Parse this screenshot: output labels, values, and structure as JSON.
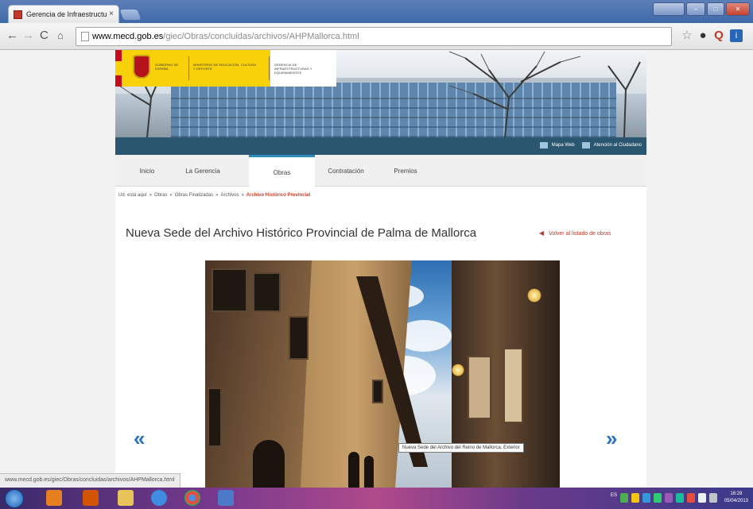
{
  "browser": {
    "tab_title": "Gerencia de Infraestructu",
    "tab_close": "×",
    "user_button": "",
    "url_host": "www.mecd.gob.es",
    "url_path": "/giec/Obras/concluidas/archivos/AHPMallorca.html",
    "status_url": "www.mecd.gob.es/giec/Obras/concluidas/archivos/AHPMallorca.html",
    "icons": [
      "back-icon",
      "forward-icon",
      "reload-icon",
      "home-icon",
      "star-icon"
    ]
  },
  "header": {
    "logo_gobierno": "GOBIERNO DE ESPAÑA",
    "logo_ministerio": "MINISTERIO DE EDUCACIÓN, CULTURA Y DEPORTE",
    "logo_gerencia": "GERENCIA DE INFRAESTRUCTURAS Y EQUIPAMIENTOS",
    "mapa_web": "Mapa Web",
    "atencion": "Atención al Ciudadano"
  },
  "menu": {
    "items": [
      {
        "label": "Inicio"
      },
      {
        "label": "La Gerencia"
      },
      {
        "label": "Obras"
      },
      {
        "label": "Contratación"
      },
      {
        "label": "Premios"
      }
    ],
    "active": "Obras"
  },
  "breadcrumb": {
    "prefix": "Ud. está aquí",
    "items": [
      "Obras",
      "Obras Finalizadas",
      "Archivos"
    ],
    "current": "Archivo Histórico Provincial"
  },
  "main": {
    "title": "Nueva Sede del Archivo Histórico Provincial de Palma de Mallorca",
    "back_link": "Volver al listado de obras",
    "photo_caption": "Nueva Sede del Archivo del Reino de Mallorca. Exterior",
    "prev_arrow": "«",
    "next_arrow": "»"
  },
  "taskbar": {
    "clock_time": "16:28",
    "clock_date": "05/04/2013",
    "lang": "ES"
  },
  "colors": {
    "accent_blue": "#2b5670",
    "active_tab_border": "#2b8bbd",
    "link_red": "#c0392b",
    "arrow_blue": "#2b72c4"
  }
}
